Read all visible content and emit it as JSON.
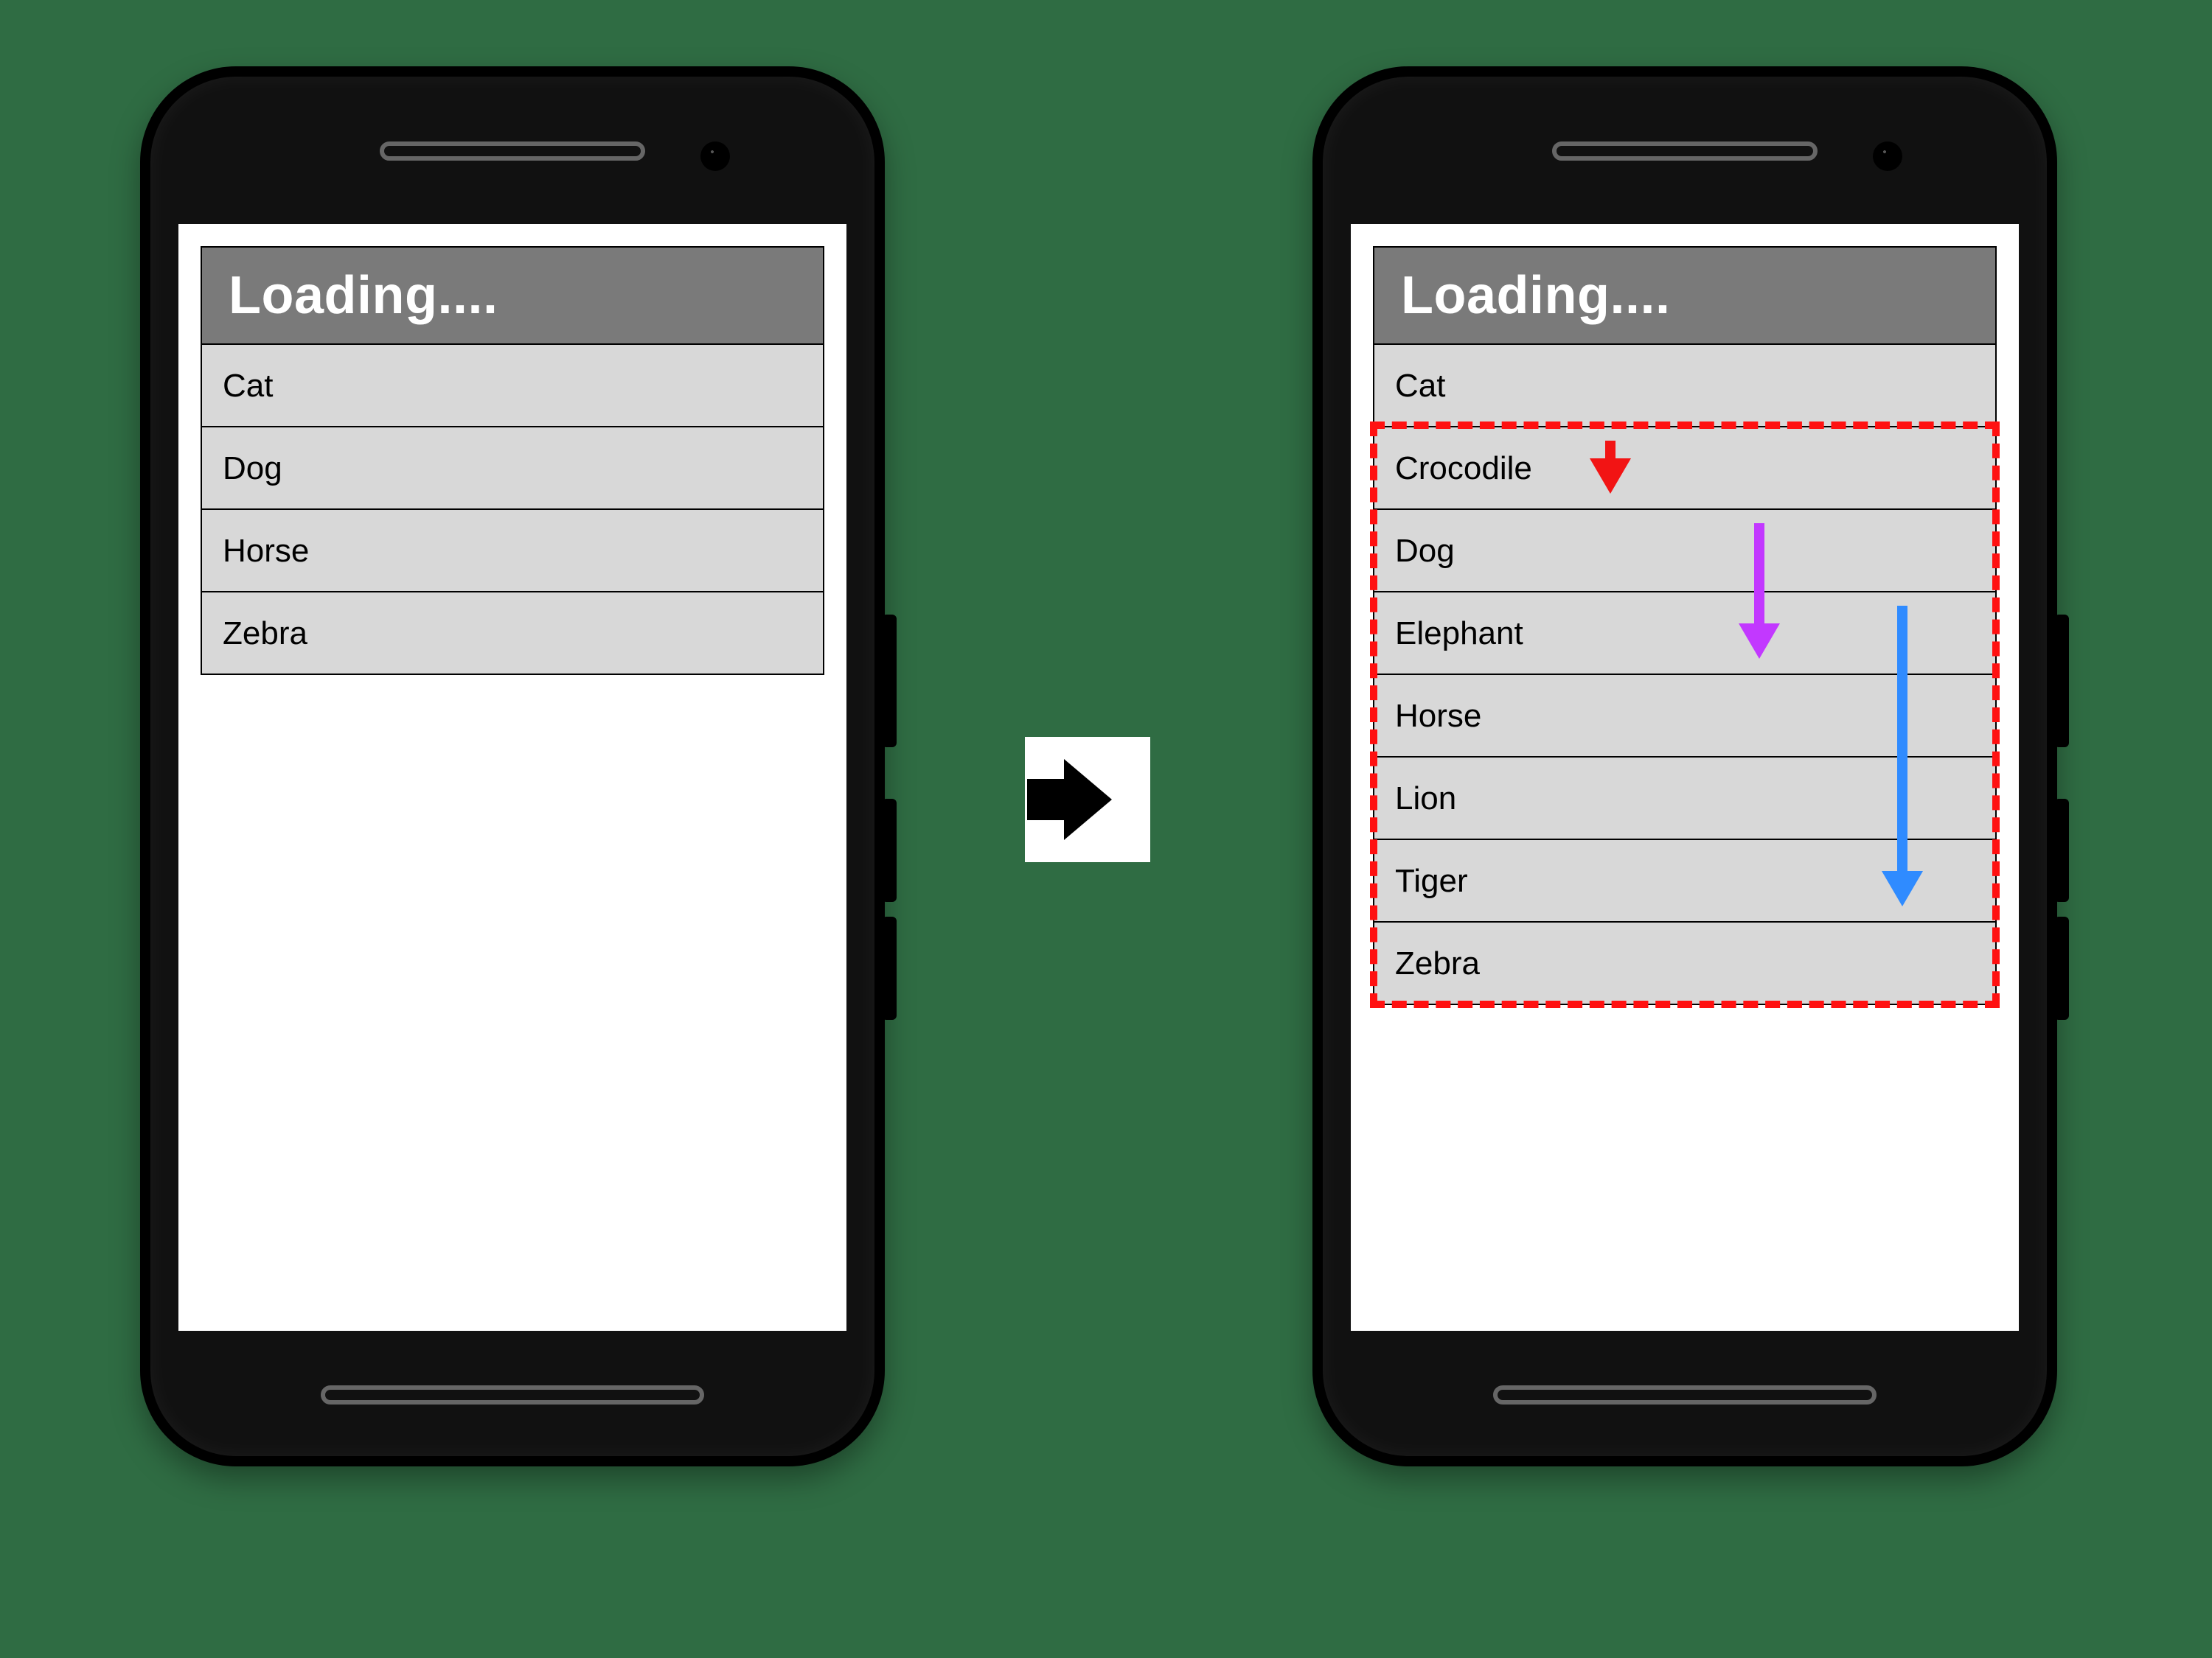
{
  "header_title": "Loading....",
  "left_list": [
    "Cat",
    "Dog",
    "Horse",
    "Zebra"
  ],
  "right_list": [
    "Cat",
    "Crocodile",
    "Dog",
    "Elephant",
    "Horse",
    "Lion",
    "Tiger",
    "Zebra"
  ],
  "highlight_range": {
    "from_index": 1,
    "to_index": 7
  },
  "annotation_arrows": [
    {
      "color": "red",
      "x_frac": 0.38,
      "from_row": 1,
      "to_row": 2
    },
    {
      "color": "purple",
      "x_frac": 0.62,
      "from_row": 2,
      "to_row": 4
    },
    {
      "color": "blue",
      "x_frac": 0.85,
      "from_row": 3,
      "to_row": 7
    }
  ]
}
